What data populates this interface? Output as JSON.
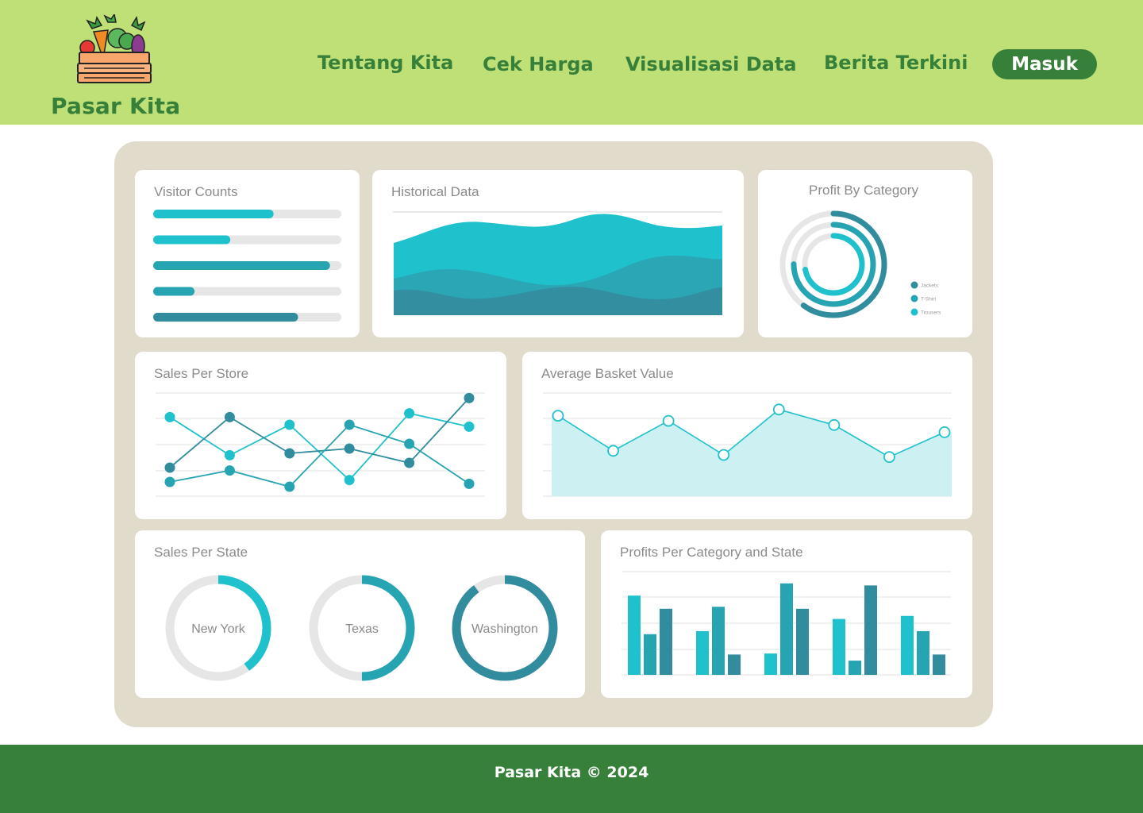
{
  "header": {
    "brand": "Pasar Kita",
    "nav": [
      {
        "label": "Tentang Kita"
      },
      {
        "label": "Cek Harga"
      },
      {
        "label": "Visualisasi Data"
      },
      {
        "label": "Berita Terkini"
      }
    ],
    "login_label": "Masuk",
    "logo_icon": "vegetable-crate-icon"
  },
  "colors": {
    "header_bg": "#bfdf77",
    "brand_green": "#37803a",
    "dashboard_bg": "#e1dbcc",
    "teal_light": "#1fc2cc",
    "teal_mid": "#27a4b1",
    "teal_dark": "#318c9d",
    "track_gray": "#e6e6e6"
  },
  "dashboard": {
    "visitor_counts": {
      "title": "Visitor Counts",
      "values": [
        0.64,
        0.41,
        0.94,
        0.22,
        0.77
      ]
    },
    "historical_data": {
      "title": "Historical Data"
    },
    "profit_by_category": {
      "title": "Profit By Category",
      "legend": [
        "Jackets",
        "T-Shirt",
        "Trousers"
      ],
      "values": [
        0.6,
        0.75,
        0.72
      ]
    },
    "sales_per_store": {
      "title": "Sales Per Store",
      "series": [
        {
          "values": [
            78,
            38,
            70,
            12,
            82,
            68
          ]
        },
        {
          "values": [
            25,
            78,
            40,
            45,
            30,
            98
          ]
        },
        {
          "values": [
            10,
            22,
            5,
            70,
            50,
            8
          ]
        }
      ]
    },
    "average_basket_value": {
      "title": "Average Basket Value",
      "values": [
        78,
        44,
        73,
        40,
        84,
        69,
        38,
        62
      ]
    },
    "sales_per_state": {
      "title": "Sales Per State",
      "states": [
        {
          "name": "New York",
          "value": 0.4
        },
        {
          "name": "Texas",
          "value": 0.5
        },
        {
          "name": "Washington",
          "value": 0.9
        }
      ]
    },
    "profits_per_category_state": {
      "title": "Profits Per Category and State",
      "groups": [
        [
          78,
          40,
          65
        ],
        [
          43,
          67,
          20
        ],
        [
          21,
          90,
          65
        ],
        [
          55,
          14,
          88
        ],
        [
          58,
          43,
          20
        ]
      ],
      "ymax": 100
    }
  },
  "footer": {
    "text": "Pasar Kita © 2024"
  }
}
